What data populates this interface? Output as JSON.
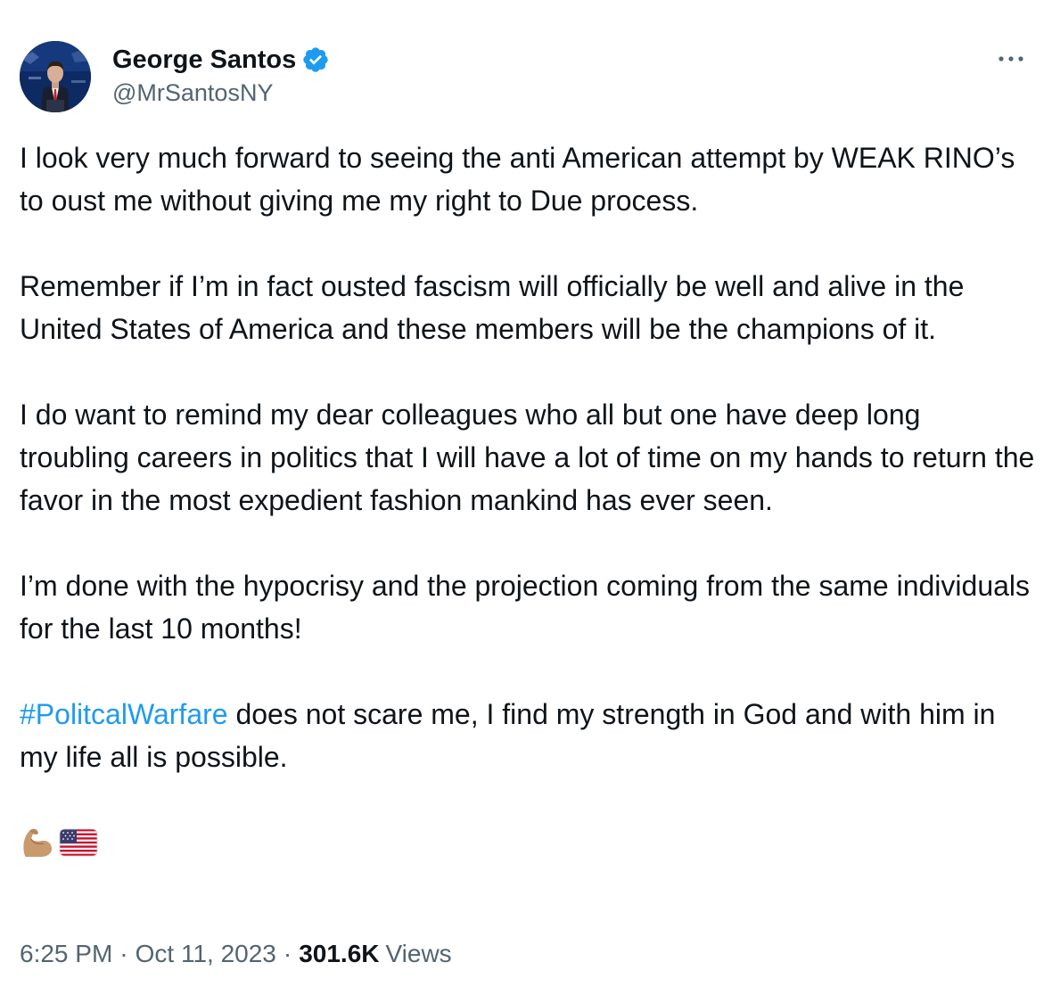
{
  "author": {
    "display_name": "George Santos",
    "handle": "@MrSantosNY",
    "verified": true
  },
  "tweet": {
    "paragraphs": [
      "I look very much forward to seeing the anti American attempt by WEAK RINO’s to oust me without giving me my right to Due process.",
      "Remember if I’m in fact ousted fascism will officially be well and alive in the United States of America and these members will be the champions of it.",
      "I do want to remind my dear colleagues who all but one have deep long troubling careers in politics that I will have a lot of time on my hands to return the favor in the most expedient fashion mankind has ever seen.",
      "I’m done with the hypocrisy and the projection coming from the same individuals for the last 10 months!"
    ],
    "last_paragraph": {
      "hashtag": "#PolitcalWarfare",
      "rest": " does not scare me, I find my strength in God and with him in my life all is possible."
    },
    "emojis": [
      "flexed-biceps-icon",
      "us-flag-icon"
    ]
  },
  "meta": {
    "time": "6:25 PM",
    "separator": "·",
    "date": "Oct 11, 2023",
    "views_count": "301.6K",
    "views_label": "Views"
  },
  "colors": {
    "text": "#0f1419",
    "secondary": "#536471",
    "link": "#1d9bf0",
    "verified_badge": "#1d9bf0"
  },
  "icons": {
    "more": "more-horizontal-icon",
    "verified": "verified-badge-icon",
    "avatar": "avatar"
  }
}
